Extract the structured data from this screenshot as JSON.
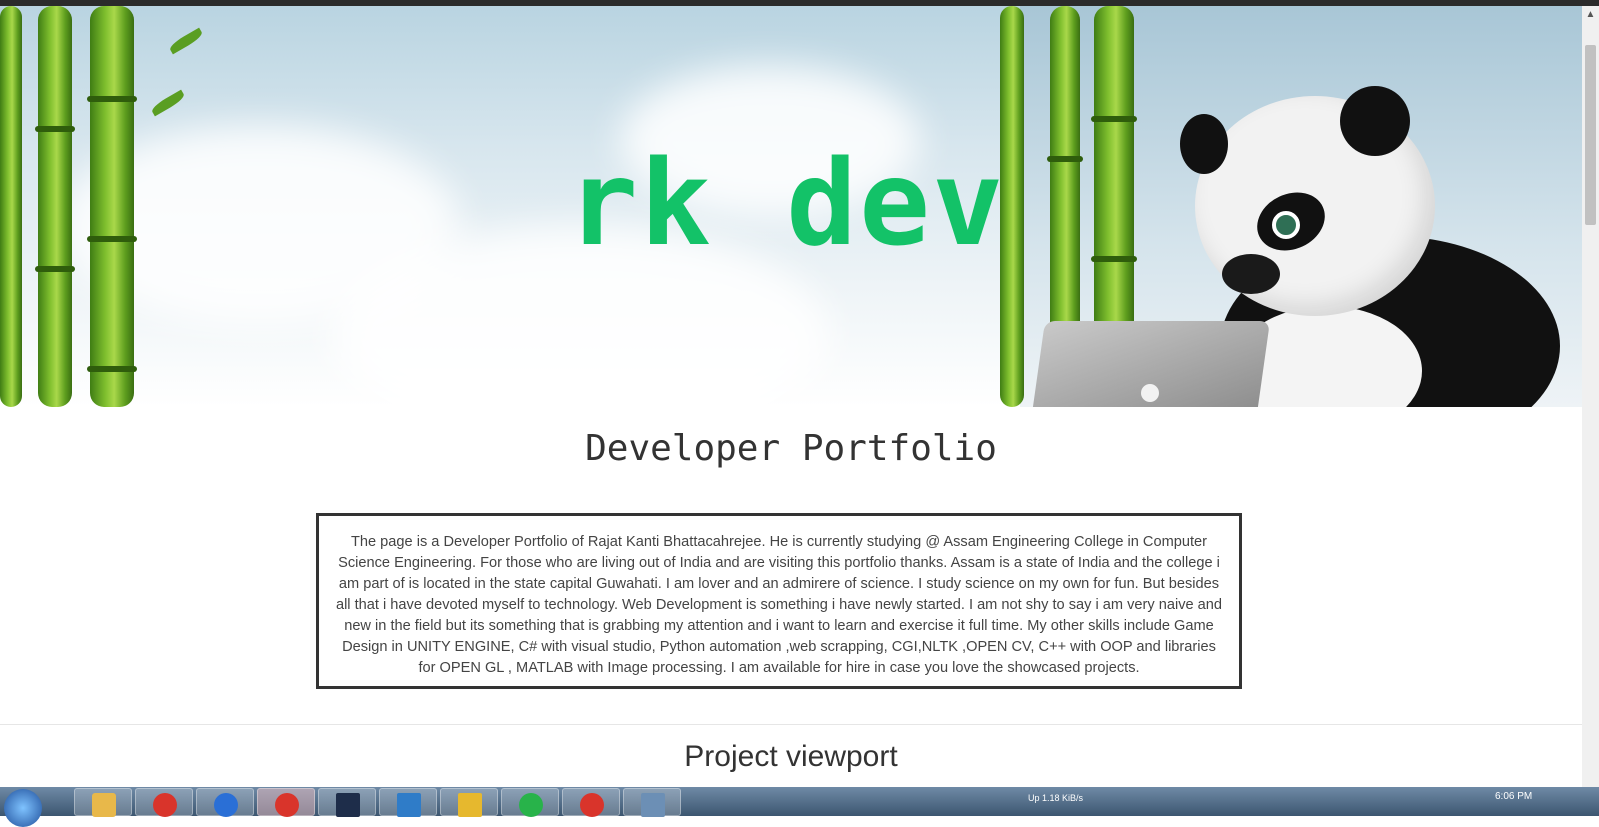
{
  "hero": {
    "logo_text": "rk dev."
  },
  "main": {
    "title": "Developer Portfolio",
    "about": "The page is a Developer Portfolio of Rajat Kanti Bhattacahrejee. He is currently studying @ Assam Engineering College in Computer Science Engineering. For those who are living out of India and are visiting this portfolio thanks. Assam is a state of India and the college i am part of is located in the state capital Guwahati. I am lover and an admirere of science. I study science on my own for fun. But besides all that i have devoted myself to technology. Web Development is something i have newly started. I am not shy to say i am very naive and new in the field but its something that is grabbing my attention and i want to learn and exercise it full time. My other skills include Game Design in UNITY ENGINE, C# with visual studio, Python automation ,web scrapping, CGI,NLTK ,OPEN CV, C++ with OOP and libraries for OPEN GL , MATLAB with Image processing. I am available for hire in case you love the showcased projects.",
    "section_title": "Project viewport"
  },
  "colors": {
    "logo_green": "#13c268",
    "text_dark": "#333333",
    "border": "#333333"
  },
  "taskbar": {
    "tray_text": "Up 1.18 KiB/s",
    "clock": "6:06 PM",
    "apps": [
      {
        "icon": "folder-icon",
        "color": "#e8b84a"
      },
      {
        "icon": "chrome-icon",
        "color": "#d9342b"
      },
      {
        "icon": "firefox-icon",
        "color": "#2a6fd6"
      },
      {
        "icon": "bird-icon",
        "color": "#d9342b"
      },
      {
        "icon": "terminal-icon",
        "color": "#1e2d4a"
      },
      {
        "icon": "window-icon",
        "color": "#2f7cc8"
      },
      {
        "icon": "sticky-note-icon",
        "color": "#e6b82e"
      },
      {
        "icon": "green-app-icon",
        "color": "#28b34a"
      },
      {
        "icon": "red-app-icon",
        "color": "#d9342b"
      },
      {
        "icon": "document-icon",
        "color": "#6c8fb5"
      }
    ]
  }
}
